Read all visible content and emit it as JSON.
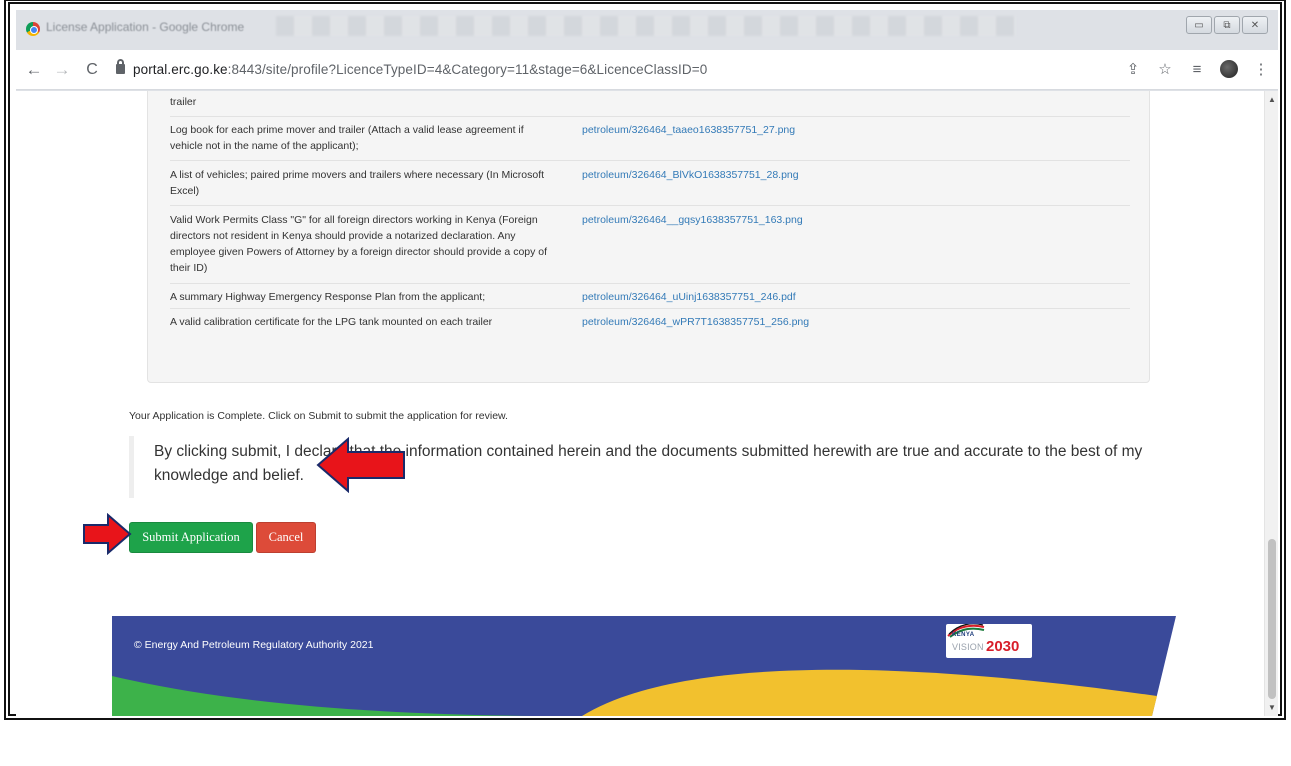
{
  "window": {
    "title": "License Application - Google Chrome",
    "controls": [
      "▭",
      "⧉",
      "✕"
    ]
  },
  "toolbar": {
    "back": "←",
    "forward": "→",
    "reload": "C",
    "url_host": "portal.erc.go.ke",
    "url_rest": ":8443/site/profile?LicenceTypeID=4&Category=11&stage=6&LicenceClassID=0",
    "icons": [
      "share-icon",
      "star-icon",
      "reading-list-icon",
      "profile-icon",
      "menu-icon"
    ],
    "share": "⇪",
    "star": "☆",
    "reading_list": "≡",
    "menu": "⋮"
  },
  "documents": {
    "partial_top": "trailer",
    "rows": [
      {
        "label": "Log book for each prime mover and trailer (Attach a valid lease agreement if vehicle not in the name of the applicant);",
        "file": "petroleum/326464_taaeo1638357751_27.png"
      },
      {
        "label": "A list of vehicles; paired prime movers and trailers where necessary (In Microsoft Excel)",
        "file": "petroleum/326464_BlVkO1638357751_28.png"
      },
      {
        "label": "Valid Work Permits Class \"G\" for all foreign directors working in Kenya (Foreign directors not resident in Kenya should provide a notarized declaration. Any employee given Powers of Attorney by a foreign director should provide a copy of their ID)",
        "file": "petroleum/326464__gqsy1638357751_163.png"
      },
      {
        "label": "A summary Highway Emergency Response Plan from the applicant;",
        "file": "petroleum/326464_uUinj1638357751_246.pdf"
      },
      {
        "label": "A valid calibration certificate for the LPG tank mounted on each trailer",
        "file": "petroleum/326464_wPR7T1638357751_256.png"
      }
    ]
  },
  "complete_message": "Your Application is Complete. Click on Submit to submit the application for review.",
  "declaration": "By clicking submit, I declare that the information contained herein and the documents submitted herewith are true and accurate to the best of my knowledge and belief.",
  "buttons": {
    "submit": "Submit Application",
    "cancel": "Cancel"
  },
  "footer": {
    "copyright": "© Energy And Petroleum Regulatory Authority 2021",
    "logo_kenya": "KENYA",
    "logo_vision": "VISION",
    "logo_year": "2030"
  },
  "colors": {
    "submit": "#1ea34a",
    "cancel": "#dd4b39",
    "link": "#337ab7",
    "footer_blue": "#3a4a9a",
    "footer_green": "#3db24a",
    "footer_yellow": "#f2c12e",
    "annotation_arrow": "#e8141a"
  }
}
